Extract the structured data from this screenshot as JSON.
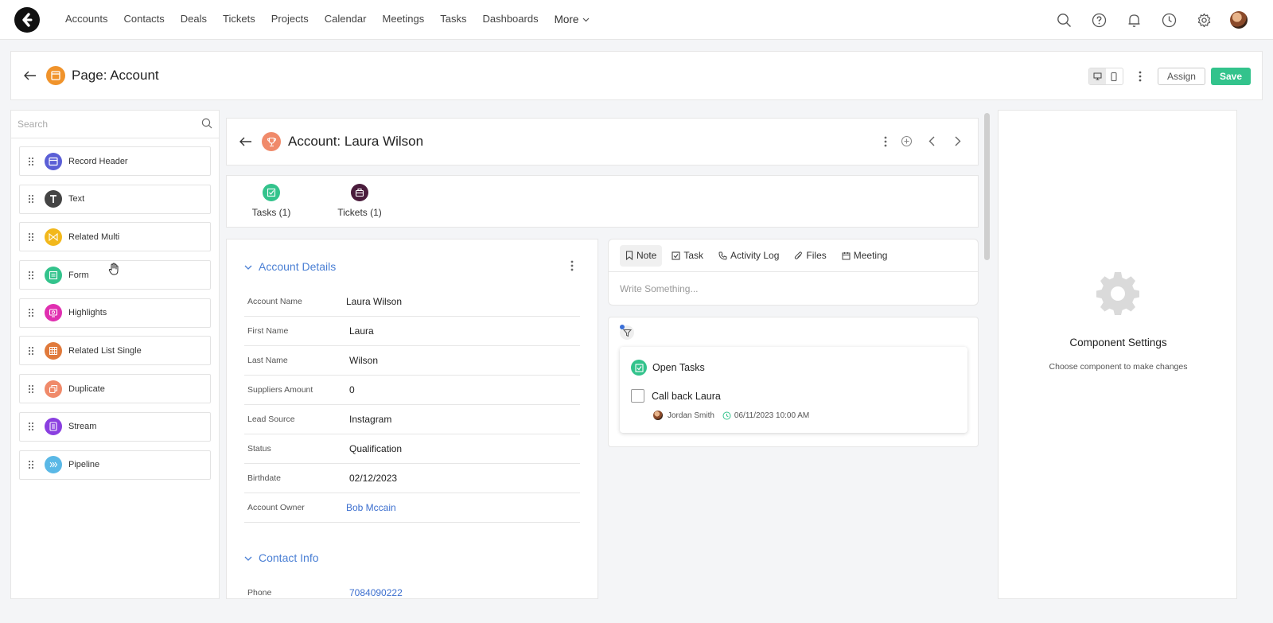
{
  "nav": {
    "links": [
      "Accounts",
      "Contacts",
      "Deals",
      "Tickets",
      "Projects",
      "Calendar",
      "Meetings",
      "Tasks",
      "Dashboards",
      "More"
    ],
    "icons": [
      "search-icon",
      "help-icon",
      "bell-icon",
      "clock-icon",
      "gear-icon"
    ]
  },
  "page": {
    "title": "Page: Account",
    "assign_label": "Assign",
    "save_label": "Save",
    "accent_color": "#33c38c"
  },
  "sidebar": {
    "search_placeholder": "Search",
    "components": [
      {
        "label": "Record Header",
        "color": "#5b5fd6",
        "icon": "record-header-icon"
      },
      {
        "label": "Text",
        "color": "#444444",
        "icon": "text-icon"
      },
      {
        "label": "Related Multi",
        "color": "#f2b81c",
        "icon": "related-multi-icon"
      },
      {
        "label": "Form",
        "color": "#33c38c",
        "icon": "form-icon"
      },
      {
        "label": "Highlights",
        "color": "#e02fb0",
        "icon": "highlights-icon"
      },
      {
        "label": "Related List Single",
        "color": "#e07a3c",
        "icon": "related-list-icon"
      },
      {
        "label": "Duplicate",
        "color": "#f08a6a",
        "icon": "duplicate-icon"
      },
      {
        "label": "Stream",
        "color": "#8a3fe0",
        "icon": "stream-icon"
      },
      {
        "label": "Pipeline",
        "color": "#5ab8e6",
        "icon": "pipeline-icon"
      }
    ]
  },
  "record": {
    "title": "Account: Laura Wilson",
    "related_tabs": [
      {
        "label": "Tasks (1)",
        "color": "#33c38c"
      },
      {
        "label": "Tickets (1)",
        "color": "#4a1c3c"
      }
    ]
  },
  "details": {
    "section_title": "Account Details",
    "fields": [
      {
        "label": "Account Name",
        "value": "Laura Wilson"
      },
      {
        "label": "First Name",
        "value": "Laura"
      },
      {
        "label": "Last Name",
        "value": "Wilson"
      },
      {
        "label": "Suppliers Amount",
        "value": "0"
      },
      {
        "label": "Lead Source",
        "value": "Instagram"
      },
      {
        "label": "Status",
        "value": "Qualification"
      },
      {
        "label": "Birthdate",
        "value": "02/12/2023"
      },
      {
        "label": "Account Owner",
        "value": "Bob Mccain"
      }
    ],
    "contact_section_title": "Contact Info",
    "contact_fields": [
      {
        "label": "Phone",
        "value": "7084090222"
      }
    ]
  },
  "composer": {
    "tabs": [
      "Note",
      "Task",
      "Activity Log",
      "Files",
      "Meeting"
    ],
    "placeholder": "Write Something..."
  },
  "tasks": {
    "group_title": "Open Tasks",
    "items": [
      {
        "title": "Call back Laura",
        "owner": "Jordan Smith",
        "due": "06/11/2023 10:00 AM"
      }
    ]
  },
  "settings": {
    "title": "Component Settings",
    "subtitle": "Choose component to make changes"
  }
}
